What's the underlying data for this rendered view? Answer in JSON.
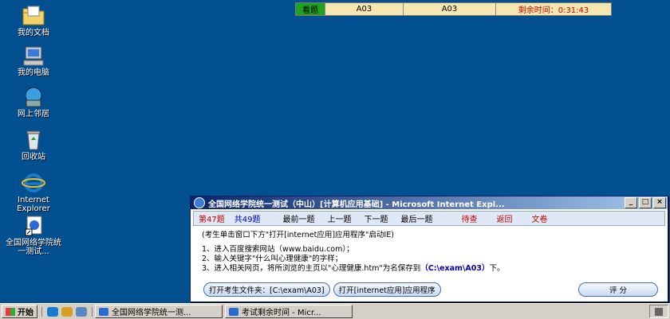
{
  "desktop": {
    "icons": [
      {
        "label": "我的文档"
      },
      {
        "label": "我的电脑"
      },
      {
        "label": "网上邻居"
      },
      {
        "label": "回收站"
      },
      {
        "label": "Internet Explorer"
      },
      {
        "label": "全国网络学院统一测试..."
      }
    ]
  },
  "exam_bar": {
    "status": "看题",
    "field1": "A03",
    "field2": "A03",
    "time_label": "剩余时间：0:31:43"
  },
  "window": {
    "title": "全国网络学院统一测试（中山）[计算机应用基础] - Microsoft Internet Expl...",
    "nav": {
      "current_q": "第47题",
      "total_q": "共49题",
      "first": "最前一题",
      "prev": "上一题",
      "next": "下一题",
      "last": "最后一题",
      "pending": "待查",
      "back": "返回",
      "doc": "文卷"
    },
    "content": {
      "hint": "(考生单击窗口下方\"打开[internet应用]应用程序\"启动IE)",
      "step1": "1、进入百度搜索网站（www.baidu.com）；",
      "step2": "2、输入关键字\"什么叫心理健康\"的字样；",
      "step3_prefix": "3、进入相关网页，将所浏览的主页以\"心理健康.htm\"为名保存到",
      "step3_path": "（C:\\exam\\A03）",
      "step3_suffix": "下。"
    },
    "buttons": {
      "open_folder": "打开考生文件夹：[C:\\exam\\A03]",
      "open_app": "打开[internet应用]应用程序",
      "score": "评  分"
    }
  },
  "taskbar": {
    "start": "开始",
    "task1": "全国网络学院统一测...",
    "task2": "考试剩余时间 - Micr..."
  }
}
